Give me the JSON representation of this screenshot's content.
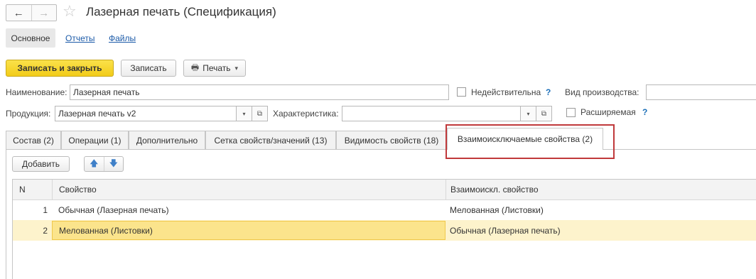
{
  "window": {
    "title": "Лазерная печать (Спецификация)",
    "back_icon": "←",
    "forward_icon": "→",
    "favorite_icon": "☆"
  },
  "sections": {
    "main": "Основное",
    "reports": "Отчеты",
    "files": "Файлы"
  },
  "toolbar": {
    "save_close": "Записать и закрыть",
    "save": "Записать",
    "print": "Печать",
    "print_icon": "🖶",
    "dropdown_icon": "▾"
  },
  "form": {
    "name_label": "Наименование:",
    "name_value": "Лазерная печать",
    "invalid_label": "Недействительна",
    "help": "?",
    "production_type_label": "Вид производства:",
    "production_type_value": "",
    "product_label": "Продукция:",
    "product_value": "Лазерная печать v2",
    "characteristic_label": "Характеристика:",
    "characteristic_value": "",
    "extended_label": "Расширяемая",
    "dropdown_glyph": "▾",
    "open_glyph": "⧉"
  },
  "tabs": [
    {
      "label": "Состав (2)"
    },
    {
      "label": "Операции (1)"
    },
    {
      "label": "Дополнительно"
    },
    {
      "label": "Сетка свойств/значений (13)"
    },
    {
      "label": "Видимость свойств (18)"
    },
    {
      "label": "Взаимоисключаемые свойства (2)",
      "active": true
    }
  ],
  "subtoolbar": {
    "add": "Добавить",
    "up_icon": "🡅",
    "down_icon": "🡇"
  },
  "table": {
    "columns": [
      "N",
      "Свойство",
      "Взаимоискл. свойство"
    ],
    "rows": [
      {
        "n": "1",
        "property": "Обычная (Лазерная печать)",
        "exclusive": "Мелованная (Листовки)"
      },
      {
        "n": "2",
        "property": "Мелованная (Листовки)",
        "exclusive": "Обычная (Лазерная печать)",
        "selected": true
      }
    ]
  },
  "colors": {
    "accent_button": "#f5d327",
    "selected_row": "#fdf3cc",
    "selected_cell": "#fbe48c",
    "link": "#1b5aa8",
    "highlight_box": "#c0393b"
  }
}
